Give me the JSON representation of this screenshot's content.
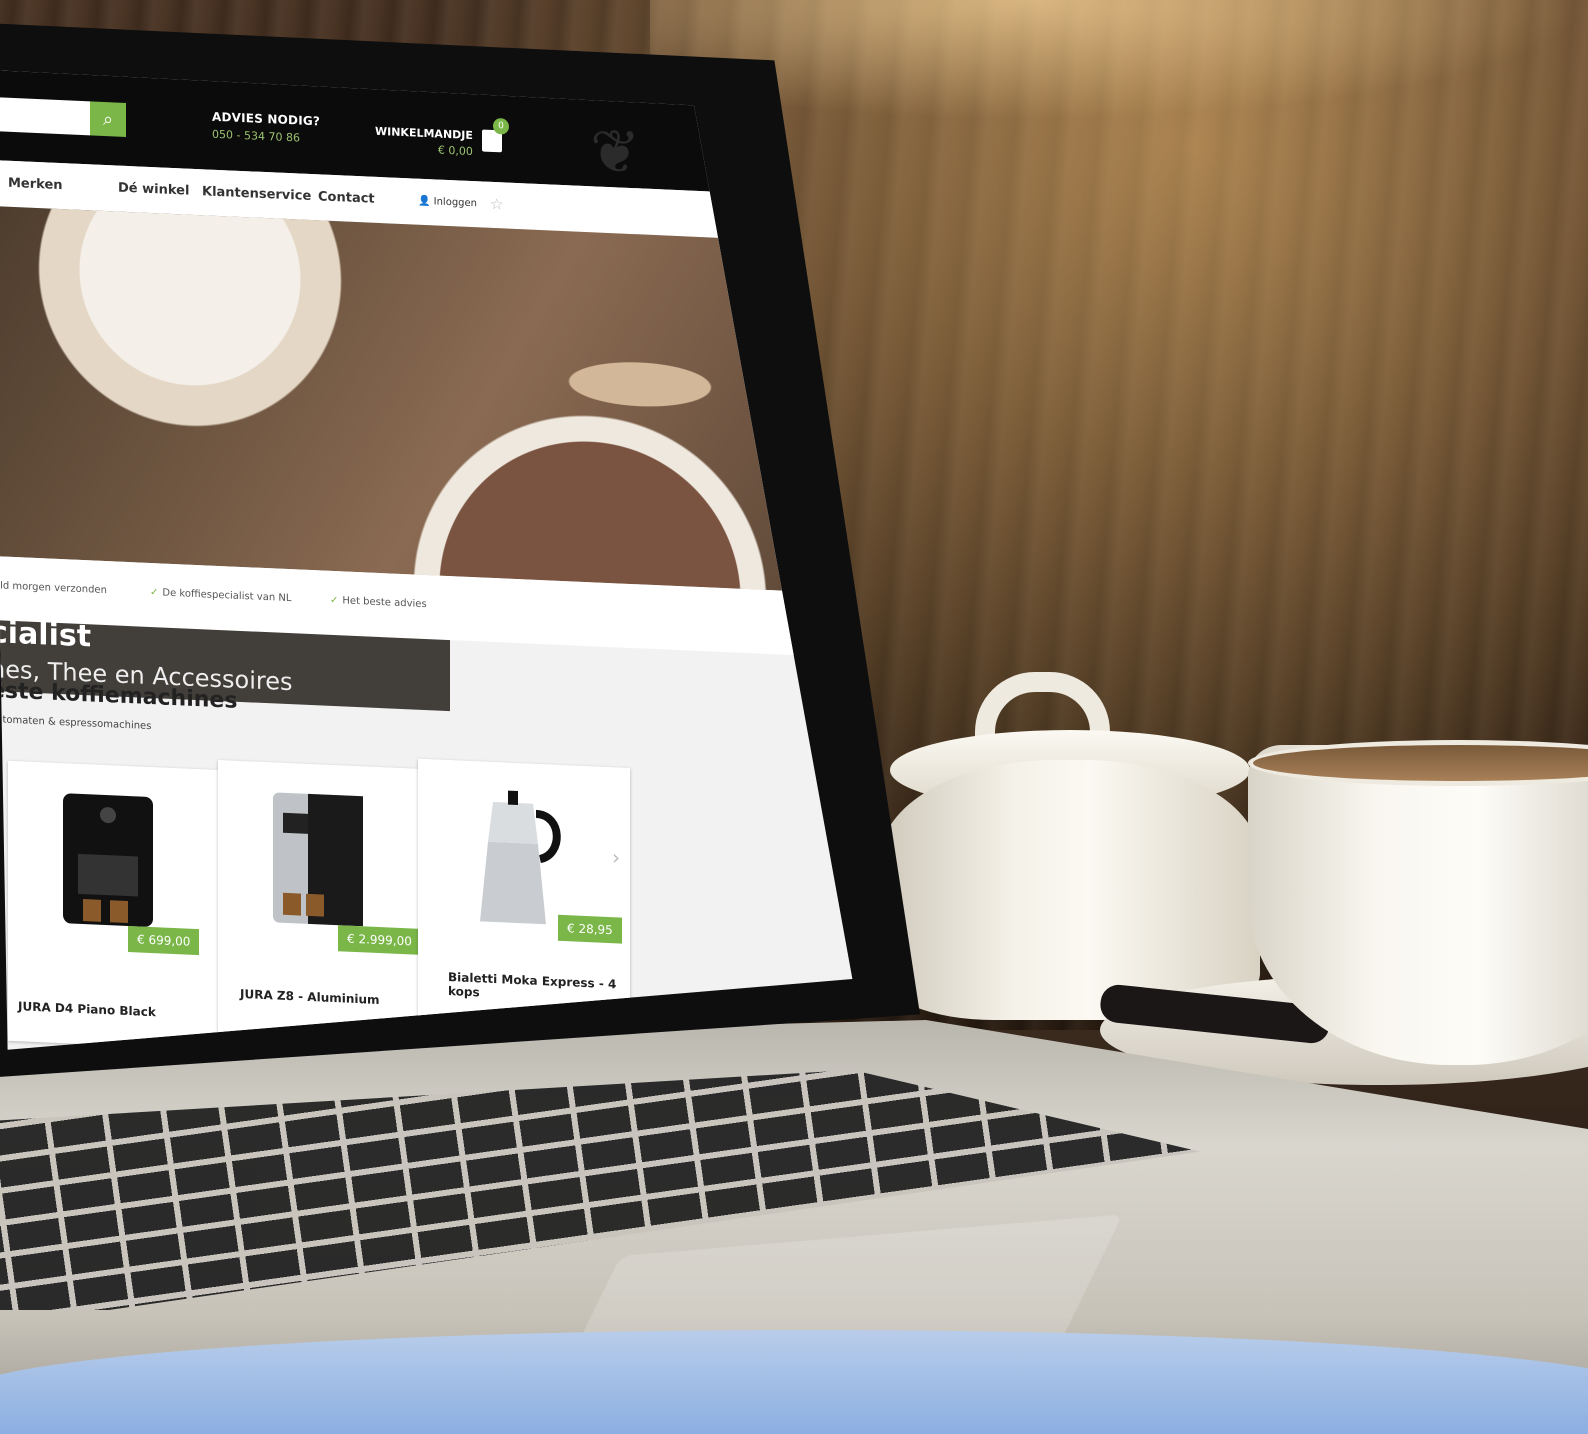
{
  "site": {
    "header": {
      "advice_title": "ADVIES NODIG?",
      "advice_phone": "050 - 534 70 86",
      "cart_title": "WINKELMANDJE",
      "cart_total": "€ 0,00",
      "cart_count": "0"
    },
    "nav": {
      "items": [
        "Merken",
        "Dé winkel",
        "Klantenservice",
        "Contact"
      ],
      "login": "Inloggen"
    },
    "hero": {
      "title_fragment": "cialist",
      "subtitle_fragment": "nes, Thee en Accessoires"
    },
    "usps": [
      "teld morgen verzonden",
      "De koffiespecialist van NL",
      "Het beste advies"
    ],
    "section": {
      "title_fragment": "éste koffiemachines",
      "subtitle_fragment": "automaten & espressomachines"
    },
    "products": [
      {
        "name": "JURA D4 Piano Black",
        "price": "€ 699,00"
      },
      {
        "name": "JURA Z8 - Aluminium",
        "price": "€ 2.999,00"
      },
      {
        "name": "Bialetti Moka Express - 4 kops",
        "price": "€ 28,95"
      }
    ]
  },
  "icons": [
    "search-icon",
    "bag-icon",
    "user-icon",
    "star-icon",
    "check-icon",
    "chevron-right-icon"
  ],
  "colors": {
    "accent_green": "#7ab648",
    "header_black": "#0b0b0b"
  }
}
